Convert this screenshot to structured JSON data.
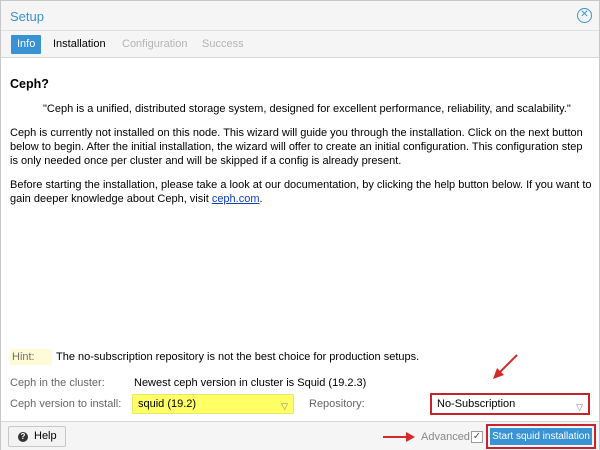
{
  "window": {
    "title": "Setup"
  },
  "tabs": [
    {
      "label": "Info"
    },
    {
      "label": "Installation"
    },
    {
      "label": "Configuration"
    },
    {
      "label": "Success"
    }
  ],
  "content": {
    "heading": "Ceph?",
    "quote": "\"Ceph is a unified, distributed storage system, designed for excellent performance, reliability, and scalability.\"",
    "para1": "Ceph is currently not installed on this node. This wizard will guide you through the installation. Click on the next button below to begin. After the initial installation, the wizard will offer to create an initial configuration. This configuration step is only needed once per cluster and will be skipped if a config is already present.",
    "para2_text": "Before starting the installation, please take a look at our documentation, by clicking the help button below. If you want to gain deeper knowledge about Ceph, visit ",
    "para2_link": "ceph.com",
    "para2_end": "."
  },
  "hint": {
    "label": "Hint:",
    "text": "The no-subscription repository is not the best choice for production setups."
  },
  "fields": {
    "cluster_label": "Ceph in the cluster:",
    "cluster_value": "Newest ceph version in cluster is Squid (19.2.3)",
    "version_label": "Ceph version to install:",
    "version_value": "squid (19.2)",
    "repo_label": "Repository:",
    "repo_value": "No-Subscription"
  },
  "footer": {
    "help_label": "Help",
    "advanced_label": "Advanced",
    "advanced_checked": true,
    "start_label": "Start squid installation"
  },
  "colors": {
    "accent": "#3892d4",
    "highlight_yellow": "#ffff66",
    "annotation_red": "#c8222b"
  }
}
